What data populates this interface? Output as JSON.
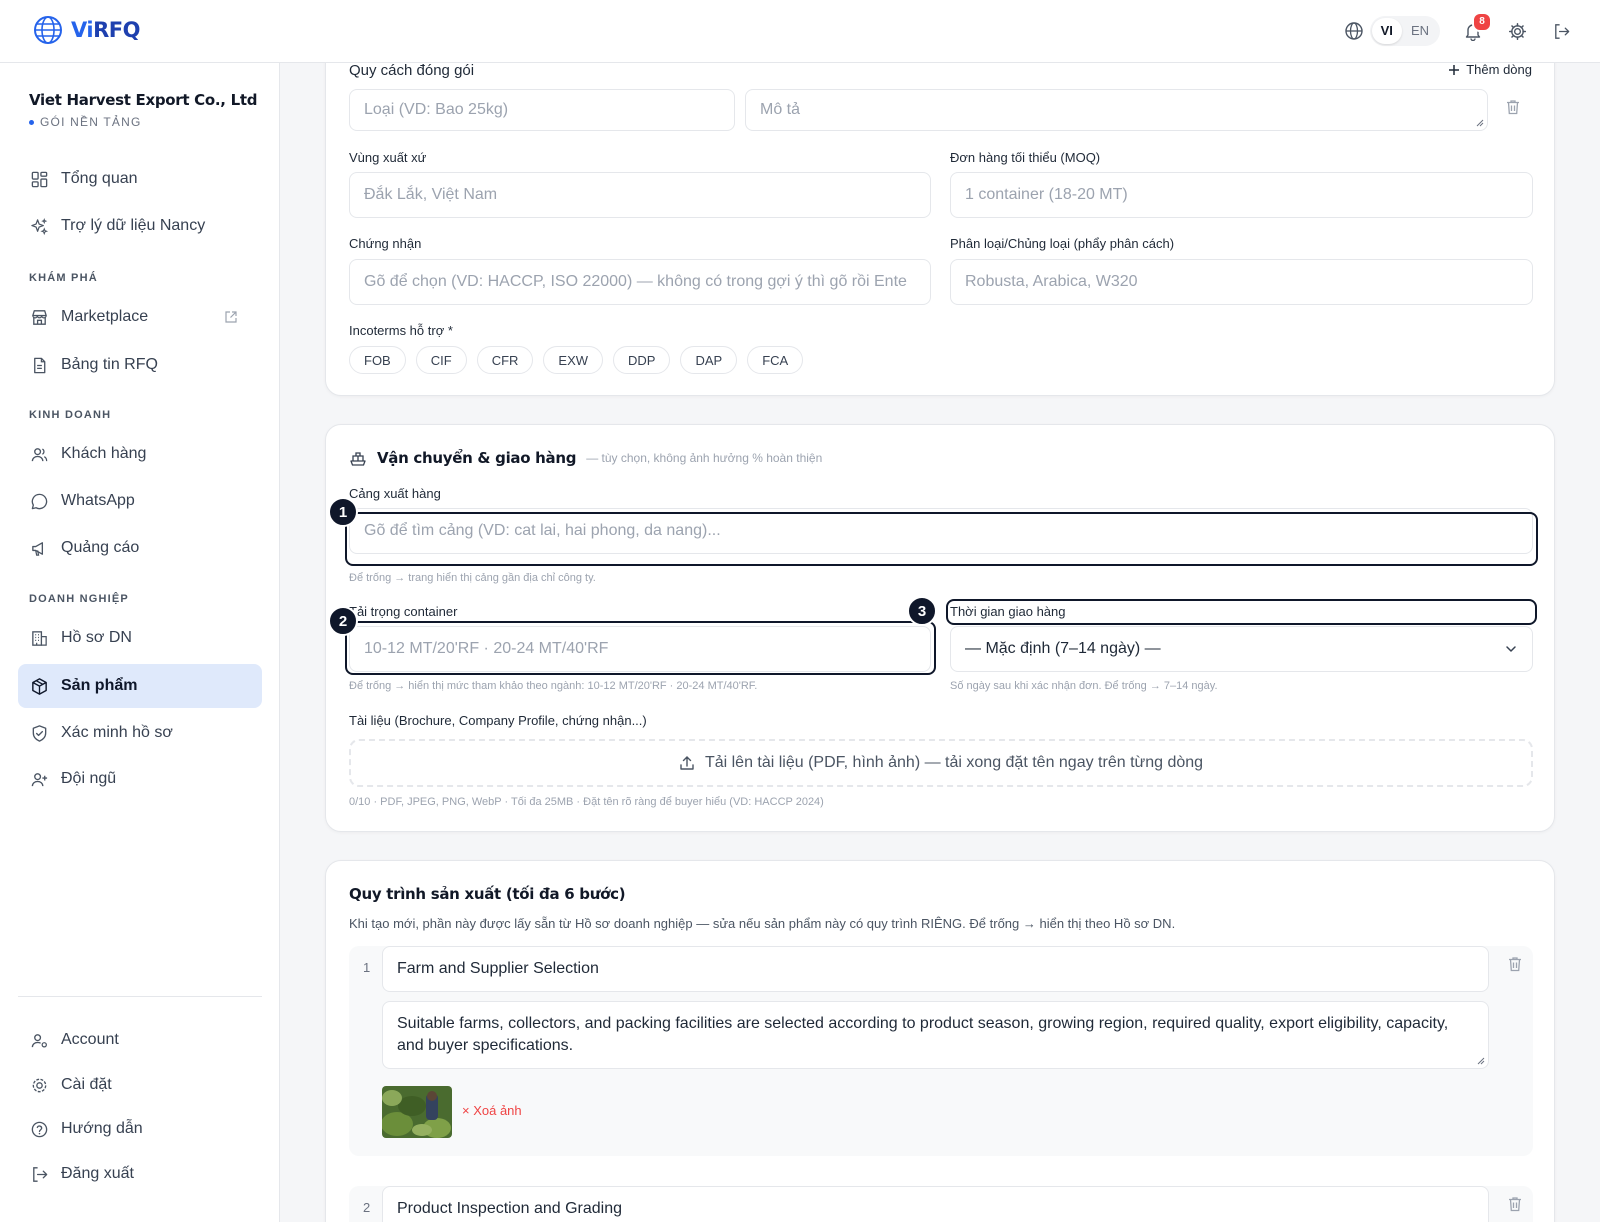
{
  "header": {
    "logo_text": "RFQ",
    "logo_prefix": "Vi",
    "lang_vi": "VI",
    "lang_en": "EN",
    "notification_count": "8"
  },
  "sidebar": {
    "company_name": "Viet Harvest Export Co., Ltd",
    "plan": "GÓI NỀN TẢNG",
    "items": {
      "overview": "Tổng quan",
      "assistant": "Trợ lý dữ liệu Nancy",
      "marketplace": "Marketplace",
      "rfq_board": "Bảng tin RFQ",
      "customers": "Khách hàng",
      "whatsapp": "WhatsApp",
      "ads": "Quảng cáo",
      "profile": "Hồ sơ DN",
      "products": "Sản phẩm",
      "verify": "Xác minh hồ sơ",
      "team": "Đội ngũ",
      "account": "Account",
      "settings": "Cài đặt",
      "guide": "Hướng dẫn",
      "logout": "Đăng xuất"
    },
    "sections": {
      "explore": "KHÁM PHÁ",
      "business": "KINH DOANH",
      "enterprise": "DOANH NGHIỆP"
    }
  },
  "packaging": {
    "label": "Quy cách đóng gói",
    "add_row": "Thêm dòng",
    "type_placeholder": "Loại (VD: Bao 25kg)",
    "desc_placeholder": "Mô tả",
    "origin_label": "Vùng xuất xứ",
    "origin_placeholder": "Đắk Lắk, Việt Nam",
    "moq_label": "Đơn hàng tối thiểu (MOQ)",
    "moq_placeholder": "1 container (18-20 MT)",
    "cert_label": "Chứng nhận",
    "cert_placeholder": "Gõ để chọn (VD: HACCP, ISO 22000) — không có trong gợi ý thì gõ rồi Ente",
    "grade_label": "Phân loại/Chủng loại (phẩy phân cách)",
    "grade_placeholder": "Robusta, Arabica, W320",
    "incoterms_label": "Incoterms hỗ trợ *",
    "incoterms": [
      "FOB",
      "CIF",
      "CFR",
      "EXW",
      "DDP",
      "DAP",
      "FCA"
    ]
  },
  "shipping": {
    "title": "Vận chuyển & giao hàng",
    "subtitle": "— tùy chọn, không ảnh hưởng % hoàn thiện",
    "port_label": "Cảng xuất hàng",
    "port_placeholder": "Gõ để tìm cảng (VD: cat lai, hai phong, da nang)...",
    "port_hint": "Để trống → trang hiển thị cảng gần địa chỉ công ty.",
    "container_label": "Tải trọng container",
    "container_placeholder": "10-12 MT/20'RF · 20-24 MT/40'RF",
    "container_hint": "Để trống → hiển thị mức tham khảo theo ngành: 10-12 MT/20'RF · 20-24 MT/40'RF.",
    "delivery_label": "Thời gian giao hàng",
    "delivery_value": "— Mặc định (7–14 ngày) —",
    "delivery_hint": "Số ngày sau khi xác nhận đơn. Để trống → 7–14 ngày.",
    "docs_label": "Tài liệu (Brochure, Company Profile, chứng nhận...)",
    "upload_text": "Tải lên tài liệu (PDF, hình ảnh) — tải xong đặt tên ngay trên từng dòng",
    "docs_hint": "0/10 · PDF, JPEG, PNG, WebP · Tối đa 25MB · Đặt tên rõ ràng để buyer hiểu (VD: HACCP 2024)",
    "markers": [
      "1",
      "2",
      "3"
    ]
  },
  "process": {
    "title": "Quy trình sản xuất (tối đa 6 bước)",
    "description": "Khi tạo mới, phần này được lấy sẵn từ Hồ sơ doanh nghiệp — sửa nếu sản phẩm này có quy trình RIÊNG. Để trống → hiển thị theo Hồ sơ DN.",
    "steps": [
      {
        "num": "1",
        "title": "Farm and Supplier Selection",
        "desc": "Suitable farms, collectors, and packing facilities are selected according to product season, growing region, required quality, export eligibility, capacity, and buyer specifications.",
        "remove_image": "× Xoá ảnh"
      },
      {
        "num": "2",
        "title": "Product Inspection and Grading"
      }
    ]
  }
}
